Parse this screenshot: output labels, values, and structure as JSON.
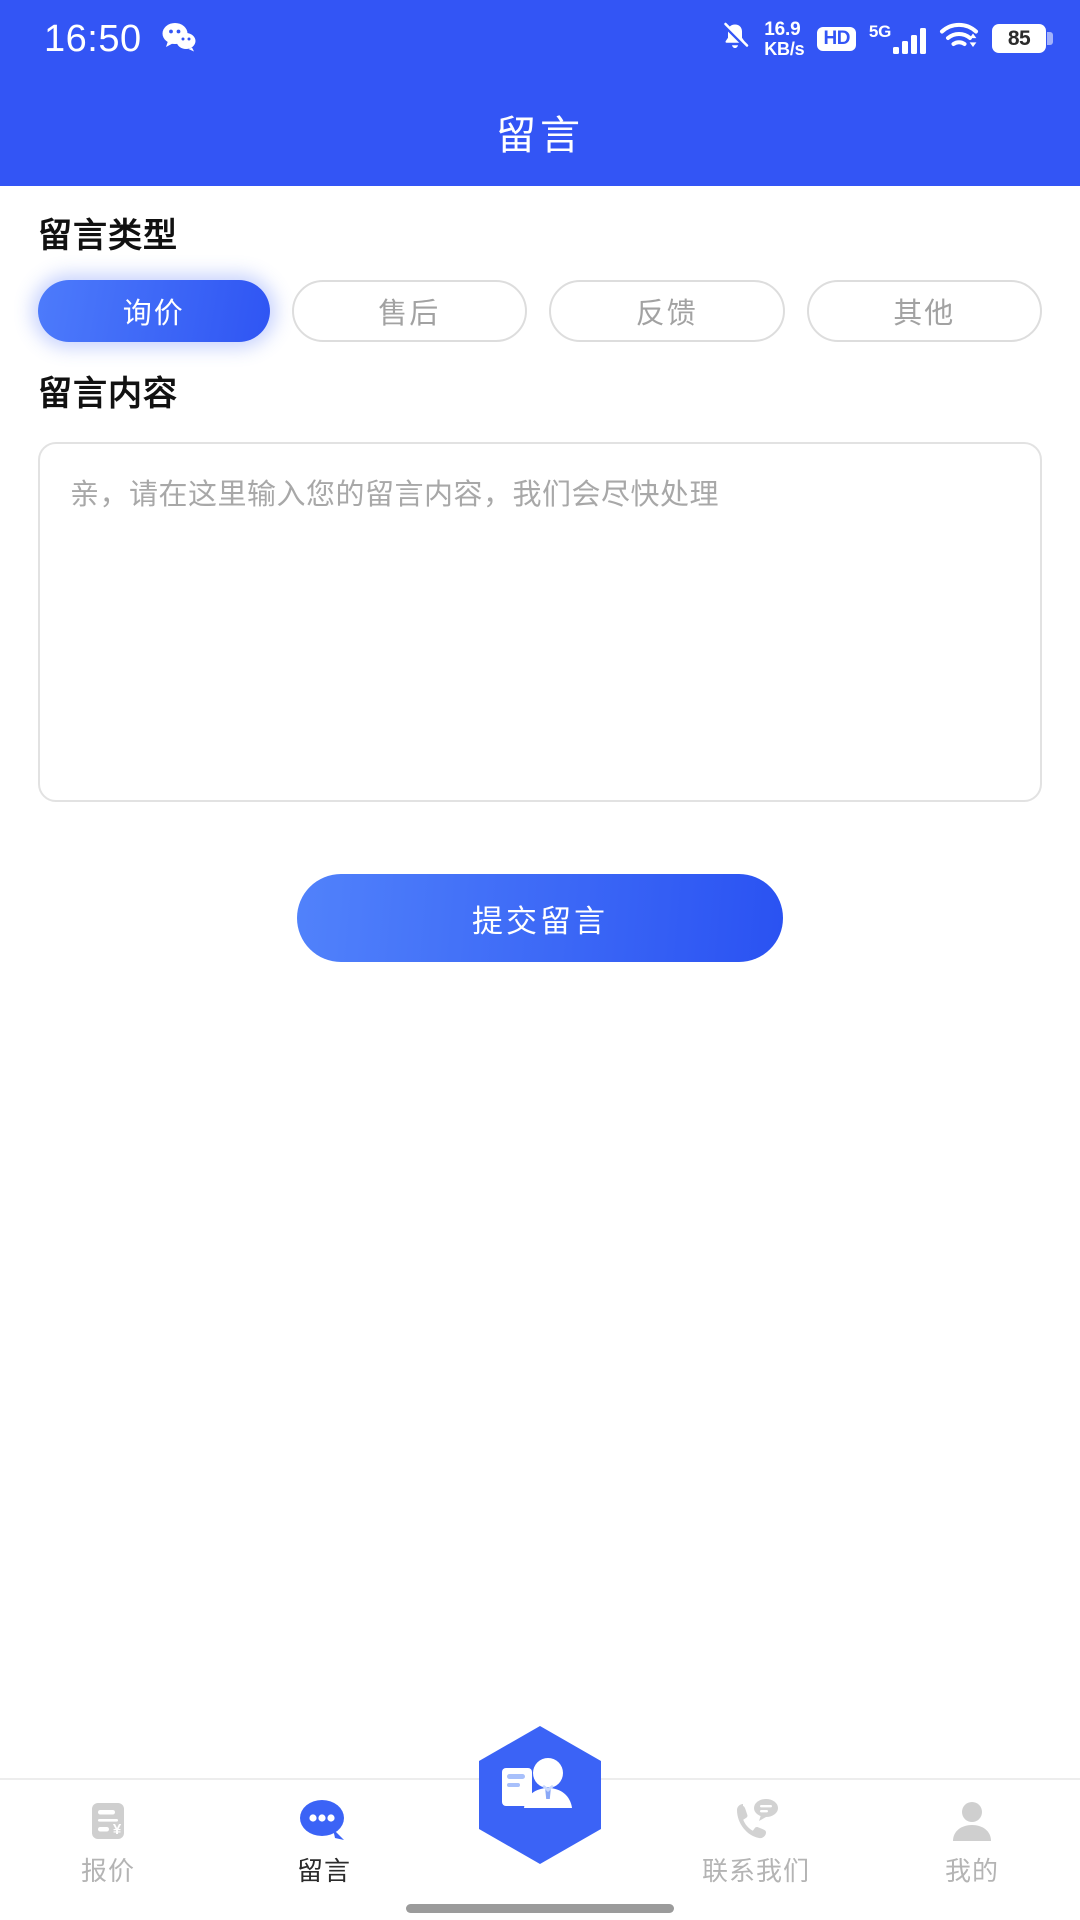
{
  "status_bar": {
    "time": "16:50",
    "app_icon": "wechat-icon",
    "mute_icon": "bell-muted-icon",
    "network_speed": "16.9",
    "network_speed_unit": "KB/s",
    "hd_badge": "HD",
    "cellular_label": "5G",
    "wifi_icon": "wifi-icon",
    "battery_level": "85"
  },
  "header": {
    "title": "留言"
  },
  "main": {
    "type_section_title": "留言类型",
    "types": [
      {
        "label": "询价",
        "selected": true
      },
      {
        "label": "售后",
        "selected": false
      },
      {
        "label": "反馈",
        "selected": false
      },
      {
        "label": "其他",
        "selected": false
      }
    ],
    "content_section_title": "留言内容",
    "message_value": "",
    "message_placeholder": "亲，请在这里输入您的留言内容，我们会尽快处理",
    "submit_label": "提交留言"
  },
  "tabbar": {
    "items": [
      {
        "label": "报价",
        "icon": "receipt-yuan-icon",
        "active": false
      },
      {
        "label": "留言",
        "icon": "chat-bubble-dots-icon",
        "active": true
      },
      {
        "label": "联系我们",
        "icon": "phone-message-icon",
        "active": false
      },
      {
        "label": "我的",
        "icon": "person-icon",
        "active": false
      }
    ],
    "center_button_icon": "id-card-person-icon"
  },
  "colors": {
    "brand_blue": "#3355f5",
    "accent_gradient_from": "#5182fb",
    "accent_gradient_to": "#2a52f2",
    "muted_text": "#a8a8a8",
    "border": "#e2e2e2"
  }
}
